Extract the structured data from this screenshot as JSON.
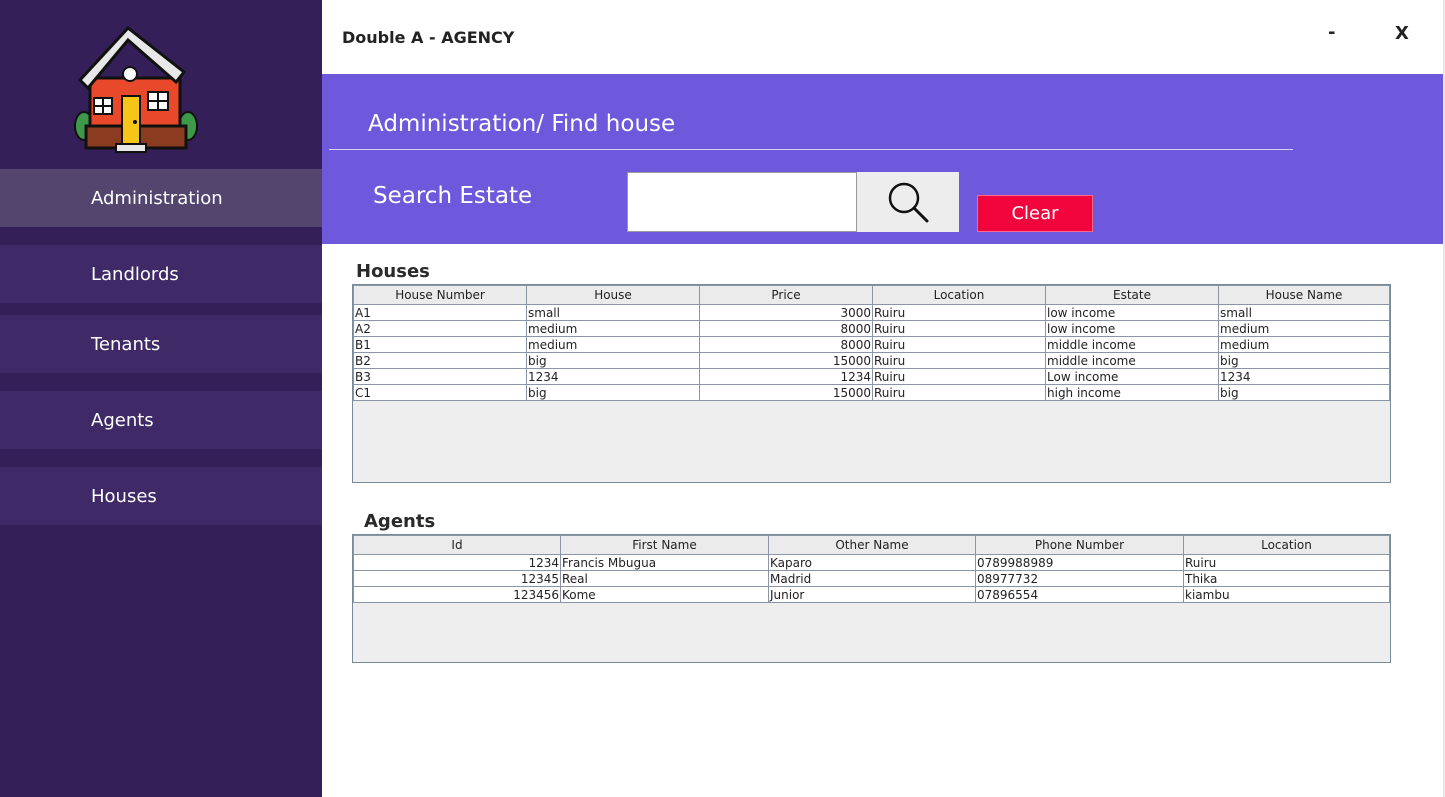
{
  "app": {
    "title": "Double A - AGENCY",
    "minimize": "-",
    "close": "X"
  },
  "sidebar": {
    "items": [
      {
        "label": "Administration"
      },
      {
        "label": "Landlords"
      },
      {
        "label": "Tenants"
      },
      {
        "label": "Agents"
      },
      {
        "label": "Houses"
      }
    ]
  },
  "header": {
    "heading": "Administration/ Find house",
    "search_label": "Search Estate",
    "search_value": "",
    "clear_label": "Clear"
  },
  "houses": {
    "title": "Houses",
    "columns": [
      "House Number",
      "House",
      "Price",
      "Location",
      "Estate",
      "House Name"
    ],
    "rows": [
      [
        "A1",
        "small",
        "3000",
        "Ruiru",
        "low income",
        "small"
      ],
      [
        "A2",
        "medium",
        "8000",
        "Ruiru",
        "low income",
        "medium"
      ],
      [
        "B1",
        "medium",
        "8000",
        "Ruiru",
        "middle income",
        "medium"
      ],
      [
        "B2",
        "big",
        "15000",
        "Ruiru",
        "middle income",
        "big"
      ],
      [
        "B3",
        "1234",
        "1234",
        "Ruiru",
        "Low income",
        "1234"
      ],
      [
        "C1",
        "big",
        "15000",
        "Ruiru",
        "high income",
        "big"
      ]
    ]
  },
  "agents": {
    "title": "Agents",
    "columns": [
      "Id",
      "First Name",
      "Other Name",
      "Phone Number",
      "Location"
    ],
    "rows": [
      [
        "1234",
        "Francis Mbugua",
        "Kaparo",
        "0789988989",
        "Ruiru"
      ],
      [
        "12345",
        "Real",
        "Madrid",
        "08977732",
        "Thika"
      ],
      [
        "123456",
        "Kome",
        "Junior",
        "07896554",
        "kiambu"
      ]
    ]
  },
  "colors": {
    "sidebar": "#341f58",
    "header": "#6e58db",
    "clear": "#f2053d"
  }
}
